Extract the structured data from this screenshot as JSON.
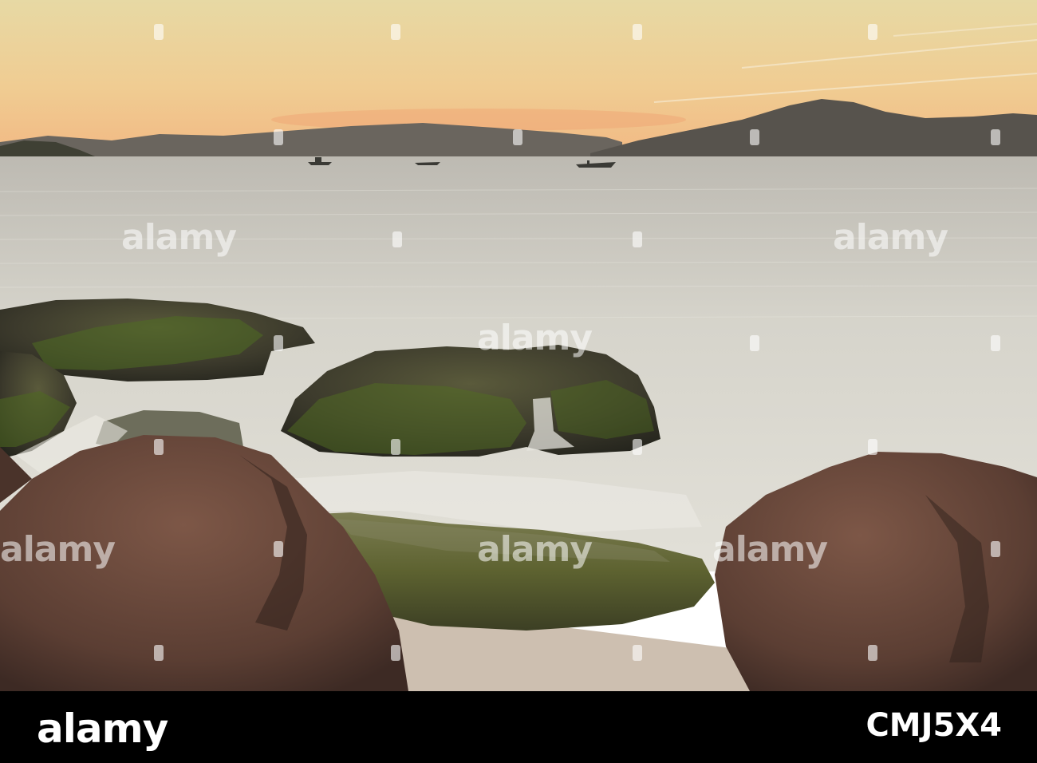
{
  "watermark": {
    "text": "alamy",
    "color": "#ffffff"
  },
  "footer": {
    "logo_text": "alamy",
    "image_id": "CMJ5X4",
    "background": "#000000"
  },
  "scene": {
    "sky_top": "#e9d9a6",
    "sky_horizon": "#f2bf86",
    "sea": "#d9d8cf",
    "mountain": "#5f5b55",
    "rock_brown": "#6a4a3c",
    "rock_moss": "#5a6a2e",
    "sand": "#cfc3b6"
  }
}
